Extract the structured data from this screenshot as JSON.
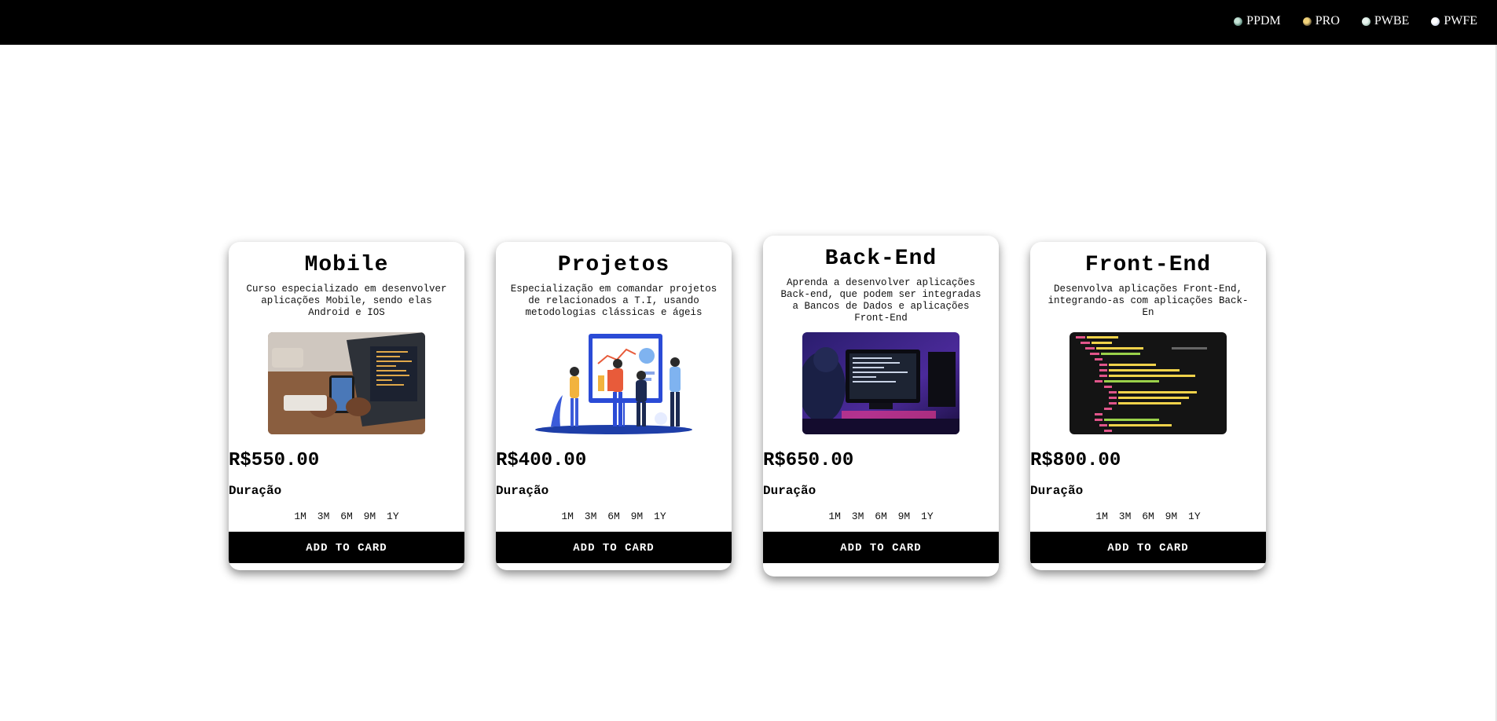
{
  "nav": {
    "items": [
      {
        "label": "PPDM",
        "icon": "ppdm-icon"
      },
      {
        "label": "PRO",
        "icon": "pro-icon"
      },
      {
        "label": "PWBE",
        "icon": "pwbe-icon"
      },
      {
        "label": "PWFE",
        "icon": "pwfe-icon"
      }
    ]
  },
  "cards": [
    {
      "title": "Mobile",
      "description": "Curso especializado em desenvolver aplicações Mobile, sendo elas Android e IOS",
      "image": "mobile-development-photo",
      "price": "R$550.00",
      "duration_label": "Duração",
      "options": [
        "1M",
        "3M",
        "6M",
        "9M",
        "1Y"
      ],
      "button": "ADD TO CARD"
    },
    {
      "title": "Projetos",
      "description": "Especialização em comandar projetos de relacionados a T.I, usando metodologias clássicas e ágeis",
      "image": "project-team-illustration",
      "price": "R$400.00",
      "duration_label": "Duração",
      "options": [
        "1M",
        "3M",
        "6M",
        "9M",
        "1Y"
      ],
      "button": "ADD TO CARD"
    },
    {
      "title": "Back-End",
      "description": "Aprenda a desenvolver aplicações Back-end, que podem ser integradas a Bancos de Dados e aplicações Front-End",
      "image": "backend-developer-photo",
      "price": "R$650.00",
      "duration_label": "Duração",
      "options": [
        "1M",
        "3M",
        "6M",
        "9M",
        "1Y"
      ],
      "button": "ADD TO CARD"
    },
    {
      "title": "Front-End",
      "description": "Desenvolva aplicações Front-End, integrando-as com aplicações Back-En",
      "image": "html-code-screenshot",
      "price": "R$800.00",
      "duration_label": "Duração",
      "options": [
        "1M",
        "3M",
        "6M",
        "9M",
        "1Y"
      ],
      "button": "ADD TO CARD"
    }
  ]
}
